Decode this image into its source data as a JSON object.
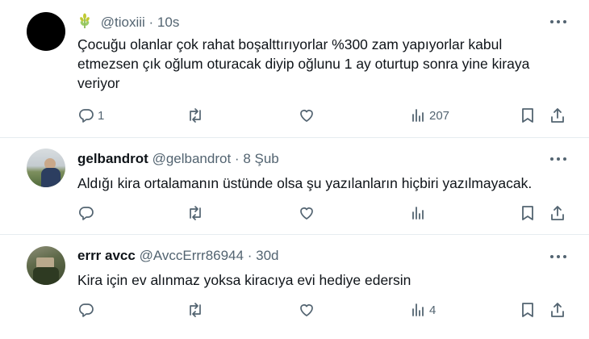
{
  "tweets": [
    {
      "name": "",
      "badge_icon": "wheat-icon",
      "handle": "@tioxiii",
      "dot": "·",
      "time": "10s",
      "text": "Çocuğu olanlar çok rahat boşalttırıyorlar %300 zam yapıyorlar kabul etmezsen çık oğlum oturacak diyip oğlunu 1 ay oturtup sonra yine kiraya veriyor",
      "stats": {
        "replies": "1",
        "reposts": "",
        "likes": "",
        "views": "207"
      }
    },
    {
      "name": "gelbandrot",
      "handle": "@gelbandrot",
      "dot": "·",
      "time": "8 Şub",
      "text": "Aldığı kira ortalamanın üstünde olsa şu yazılanların hiçbiri yazılmayacak.",
      "stats": {
        "replies": "",
        "reposts": "",
        "likes": "",
        "views": ""
      }
    },
    {
      "name": "errr avcc",
      "handle": "@AvccErrr86944",
      "dot": "·",
      "time": "30d",
      "text": "Kira için ev alınmaz yoksa kiracıya evi hediye edersin",
      "stats": {
        "replies": "",
        "reposts": "",
        "likes": "",
        "views": "4"
      }
    }
  ],
  "colors": {
    "text": "#0f1419",
    "secondary": "#536471",
    "divider": "#e6ecf0",
    "badge": "#9acd32"
  }
}
